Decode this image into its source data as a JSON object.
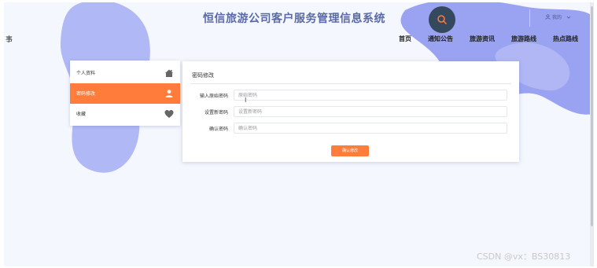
{
  "colors": {
    "accent": "#ff7c3a",
    "blob": "#8b95f0",
    "header_title": "#5a6aa6"
  },
  "header": {
    "title": "恒信旅游公司客户服务管理信息系统",
    "left_edge_text": "事",
    "search_icon": "search-icon",
    "user_label": "我的",
    "user_icon": "user-icon",
    "user_caret_icon": "chevron-down-icon"
  },
  "nav": {
    "items": [
      {
        "label": "首页"
      },
      {
        "label": "通知公告"
      },
      {
        "label": "旅游资讯"
      },
      {
        "label": "旅游路线"
      },
      {
        "label": "热点路线"
      }
    ]
  },
  "sidebar": {
    "items": [
      {
        "label": "个人资料",
        "icon": "home-icon",
        "active": false
      },
      {
        "label": "密码修改",
        "icon": "user-icon",
        "active": true
      },
      {
        "label": "收藏",
        "icon": "heart-icon",
        "active": false
      }
    ]
  },
  "panel": {
    "title": "密码修改",
    "fields": [
      {
        "label": "输入原始密码",
        "placeholder": "原始密码"
      },
      {
        "label": "设置新密码",
        "placeholder": "设置新密码"
      },
      {
        "label": "确认密码",
        "placeholder": "确认密码"
      }
    ],
    "confirm_label": "确认修改"
  },
  "watermark": "CSDN @vx：BS30813"
}
